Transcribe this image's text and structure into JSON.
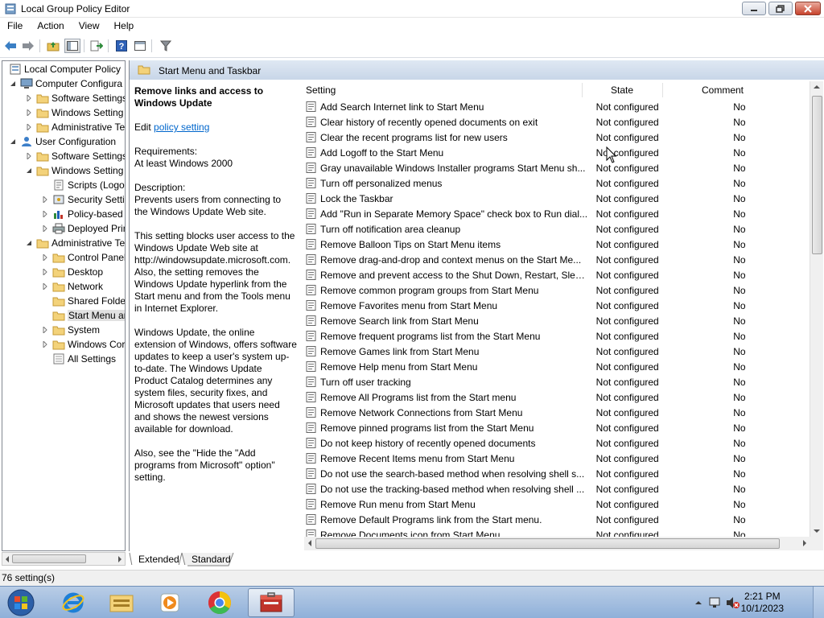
{
  "window": {
    "title": "Local Group Policy Editor"
  },
  "menu": [
    "File",
    "Action",
    "View",
    "Help"
  ],
  "tree": [
    {
      "label": "Local Computer Policy",
      "level": 0,
      "expander": "",
      "icon": "computer-policy"
    },
    {
      "label": "Computer Configura",
      "level": 1,
      "expander": "open",
      "icon": "computer"
    },
    {
      "label": "Software Settings",
      "level": 2,
      "expander": "closed",
      "icon": "folder"
    },
    {
      "label": "Windows Setting",
      "level": 2,
      "expander": "closed",
      "icon": "folder"
    },
    {
      "label": "Administrative Te",
      "level": 2,
      "expander": "closed",
      "icon": "folder"
    },
    {
      "label": "User Configuration",
      "level": 1,
      "expander": "open",
      "icon": "user"
    },
    {
      "label": "Software Settings",
      "level": 2,
      "expander": "closed",
      "icon": "folder"
    },
    {
      "label": "Windows Setting",
      "level": 2,
      "expander": "open",
      "icon": "folder"
    },
    {
      "label": "Scripts (Logon",
      "level": 3,
      "expander": "",
      "icon": "script"
    },
    {
      "label": "Security Settin",
      "level": 3,
      "expander": "closed",
      "icon": "security"
    },
    {
      "label": "Policy-based",
      "level": 3,
      "expander": "closed",
      "icon": "chart"
    },
    {
      "label": "Deployed Prin",
      "level": 3,
      "expander": "closed",
      "icon": "printer"
    },
    {
      "label": "Administrative Te",
      "level": 2,
      "expander": "open",
      "icon": "folder"
    },
    {
      "label": "Control Panel",
      "level": 3,
      "expander": "closed",
      "icon": "folder"
    },
    {
      "label": "Desktop",
      "level": 3,
      "expander": "closed",
      "icon": "folder"
    },
    {
      "label": "Network",
      "level": 3,
      "expander": "closed",
      "icon": "folder"
    },
    {
      "label": "Shared Folder",
      "level": 3,
      "expander": "",
      "icon": "folder"
    },
    {
      "label": "Start Menu ar",
      "level": 3,
      "expander": "",
      "icon": "folder",
      "selected": true
    },
    {
      "label": "System",
      "level": 3,
      "expander": "closed",
      "icon": "folder"
    },
    {
      "label": "Windows Cor",
      "level": 3,
      "expander": "closed",
      "icon": "folder"
    },
    {
      "label": "All Settings",
      "level": 3,
      "expander": "",
      "icon": "allsettings"
    }
  ],
  "pane_header": "Start Menu and Taskbar",
  "description": {
    "title": "Remove links and access to Windows Update",
    "edit_prefix": "Edit",
    "edit_link": "policy setting",
    "requirements_label": "Requirements:",
    "requirements_value": "At least Windows 2000",
    "description_label": "Description:",
    "p1": "Prevents users from connecting to the Windows Update Web site.",
    "p2": "This setting blocks user access to the Windows Update Web site at http://windowsupdate.microsoft.com. Also, the setting removes the Windows Update hyperlink from the Start menu and from the Tools menu in Internet Explorer.",
    "p3": "Windows Update, the online extension of Windows, offers software updates to keep a user's system up-to-date. The Windows Update Product Catalog determines any system files, security fixes, and Microsoft updates that users need and shows the newest versions available for download.",
    "p4": "Also, see the \"Hide the \"Add programs from Microsoft\" option\" setting."
  },
  "columns": {
    "setting": "Setting",
    "state": "State",
    "comment": "Comment"
  },
  "settings": [
    {
      "name": "Add Search Internet link to Start Menu",
      "state": "Not configured",
      "comment": "No"
    },
    {
      "name": "Clear history of recently opened documents on exit",
      "state": "Not configured",
      "comment": "No"
    },
    {
      "name": "Clear the recent programs list for new users",
      "state": "Not configured",
      "comment": "No"
    },
    {
      "name": "Add Logoff to the Start Menu",
      "state": "Not configured",
      "comment": "No"
    },
    {
      "name": "Gray unavailable Windows Installer programs Start Menu sh...",
      "state": "Not configured",
      "comment": "No"
    },
    {
      "name": "Turn off personalized menus",
      "state": "Not configured",
      "comment": "No"
    },
    {
      "name": "Lock the Taskbar",
      "state": "Not configured",
      "comment": "No"
    },
    {
      "name": "Add \"Run in Separate Memory Space\" check box to Run dial...",
      "state": "Not configured",
      "comment": "No"
    },
    {
      "name": "Turn off notification area cleanup",
      "state": "Not configured",
      "comment": "No"
    },
    {
      "name": "Remove Balloon Tips on Start Menu items",
      "state": "Not configured",
      "comment": "No"
    },
    {
      "name": "Remove drag-and-drop and context menus on the Start Me...",
      "state": "Not configured",
      "comment": "No"
    },
    {
      "name": "Remove and prevent access to the Shut Down, Restart, Sleep...",
      "state": "Not configured",
      "comment": "No"
    },
    {
      "name": "Remove common program groups from Start Menu",
      "state": "Not configured",
      "comment": "No"
    },
    {
      "name": "Remove Favorites menu from Start Menu",
      "state": "Not configured",
      "comment": "No"
    },
    {
      "name": "Remove Search link from Start Menu",
      "state": "Not configured",
      "comment": "No"
    },
    {
      "name": "Remove frequent programs list from the Start Menu",
      "state": "Not configured",
      "comment": "No"
    },
    {
      "name": "Remove Games link from Start Menu",
      "state": "Not configured",
      "comment": "No"
    },
    {
      "name": "Remove Help menu from Start Menu",
      "state": "Not configured",
      "comment": "No"
    },
    {
      "name": "Turn off user tracking",
      "state": "Not configured",
      "comment": "No"
    },
    {
      "name": "Remove All Programs list from the Start menu",
      "state": "Not configured",
      "comment": "No"
    },
    {
      "name": "Remove Network Connections from Start Menu",
      "state": "Not configured",
      "comment": "No"
    },
    {
      "name": "Remove pinned programs list from the Start Menu",
      "state": "Not configured",
      "comment": "No"
    },
    {
      "name": "Do not keep history of recently opened documents",
      "state": "Not configured",
      "comment": "No"
    },
    {
      "name": "Remove Recent Items menu from Start Menu",
      "state": "Not configured",
      "comment": "No"
    },
    {
      "name": "Do not use the search-based method when resolving shell s...",
      "state": "Not configured",
      "comment": "No"
    },
    {
      "name": "Do not use the tracking-based method when resolving shell ...",
      "state": "Not configured",
      "comment": "No"
    },
    {
      "name": "Remove Run menu from Start Menu",
      "state": "Not configured",
      "comment": "No"
    },
    {
      "name": "Remove Default Programs link from the Start menu.",
      "state": "Not configured",
      "comment": "No"
    },
    {
      "name": "Remove Documents icon from Start Menu",
      "state": "Not configured",
      "comment": "No"
    }
  ],
  "tabs": [
    "Extended",
    "Standard"
  ],
  "status": "76 setting(s)",
  "clock": {
    "time": "2:21 PM",
    "date": "10/1/2023"
  },
  "taskbar_apps": [
    "internet-explorer-icon",
    "file-explorer-icon",
    "media-player-icon",
    "chrome-icon",
    "group-policy-icon"
  ]
}
